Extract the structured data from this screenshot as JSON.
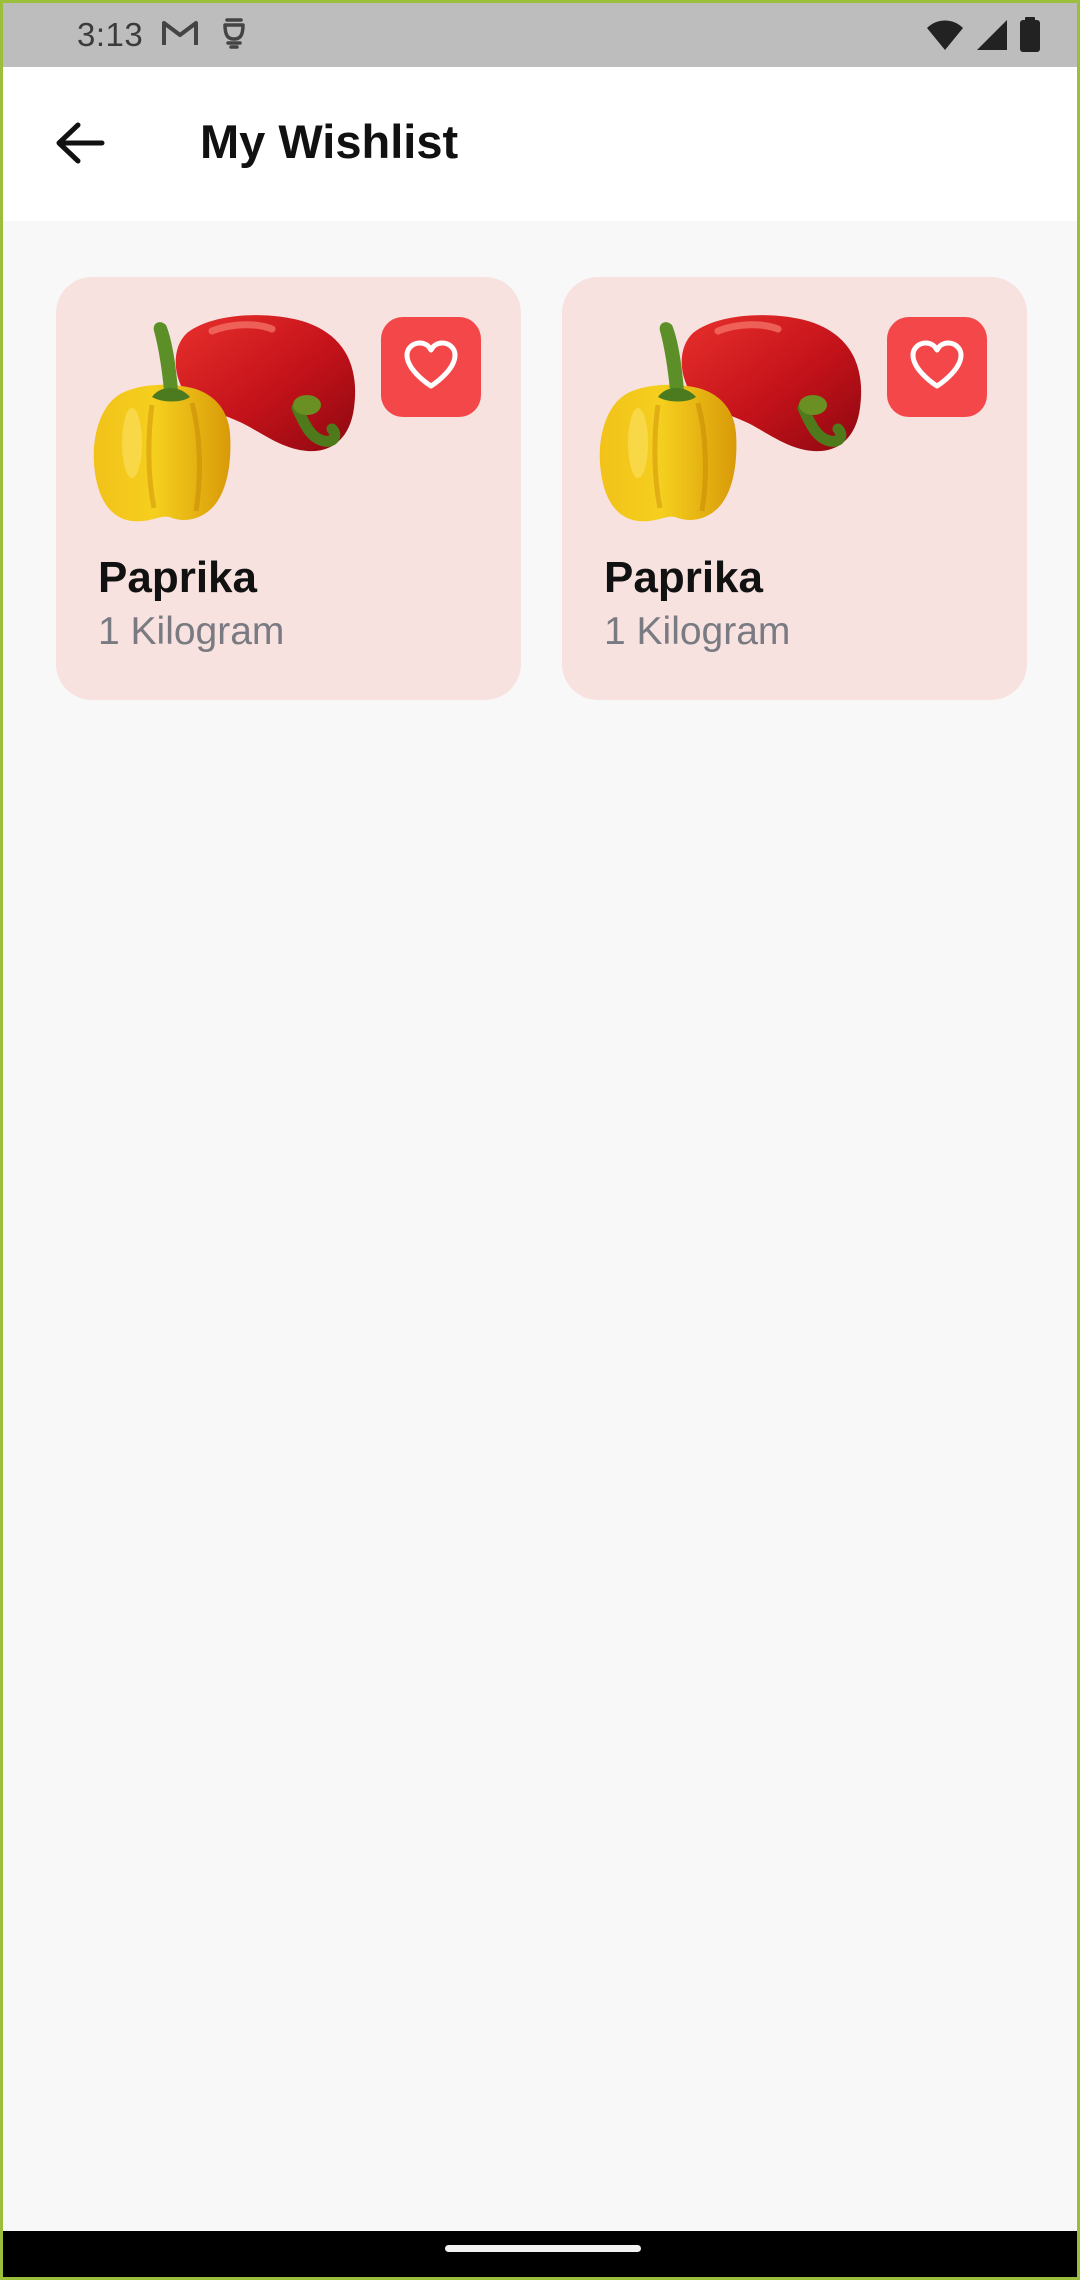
{
  "status_bar": {
    "time": "3:13",
    "left_icons": [
      "gmail-icon",
      "sim-icon"
    ],
    "right_icons": [
      "wifi-icon",
      "cell-signal-icon",
      "battery-icon"
    ]
  },
  "app_bar": {
    "title": "My Wishlist",
    "back_icon": "arrow-back-icon"
  },
  "wishlist": {
    "items": [
      {
        "name": "Paprika",
        "quantity": "1 Kilogram",
        "favorite": true,
        "image": "bell-peppers"
      },
      {
        "name": "Paprika",
        "quantity": "1 Kilogram",
        "favorite": true,
        "image": "bell-peppers"
      }
    ]
  },
  "colors": {
    "card_background": "#f7e2df",
    "favorite_button": "#f4474a",
    "page_background": "#f8f8f8",
    "status_bar": "#bdbdbd",
    "quantity_text": "#7a7a82"
  }
}
